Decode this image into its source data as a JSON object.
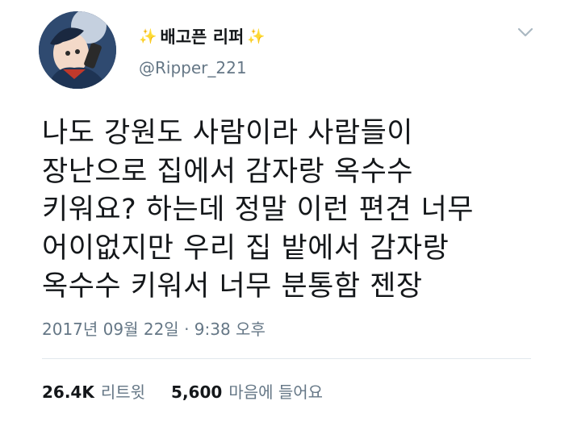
{
  "user": {
    "display_name": "배고픈 리퍼",
    "sparkle_left": "✨",
    "sparkle_right": "✨",
    "handle": "@Ripper_221"
  },
  "tweet": {
    "lines": [
      "나도 강원도 사람이라 사람들이",
      "장난으로 집에서 감자랑 옥수수",
      "키워요? 하는데 정말 이런 편견 너무",
      "어이없지만 우리 집 밭에서 감자랑",
      "옥수수 키워서 너무 분통함 젠장"
    ],
    "timestamp": "2017년 09월 22일 · 9:38 오후"
  },
  "stats": {
    "retweets_count": "26.4K",
    "retweets_label": "리트윗",
    "likes_count": "5,600",
    "likes_label": "마음에 들어요"
  },
  "icons": {
    "avatar": "profile-avatar",
    "menu": "chevron-down-icon"
  },
  "colors": {
    "text": "#14171a",
    "secondary": "#657786",
    "divider": "#e1e8ed"
  }
}
